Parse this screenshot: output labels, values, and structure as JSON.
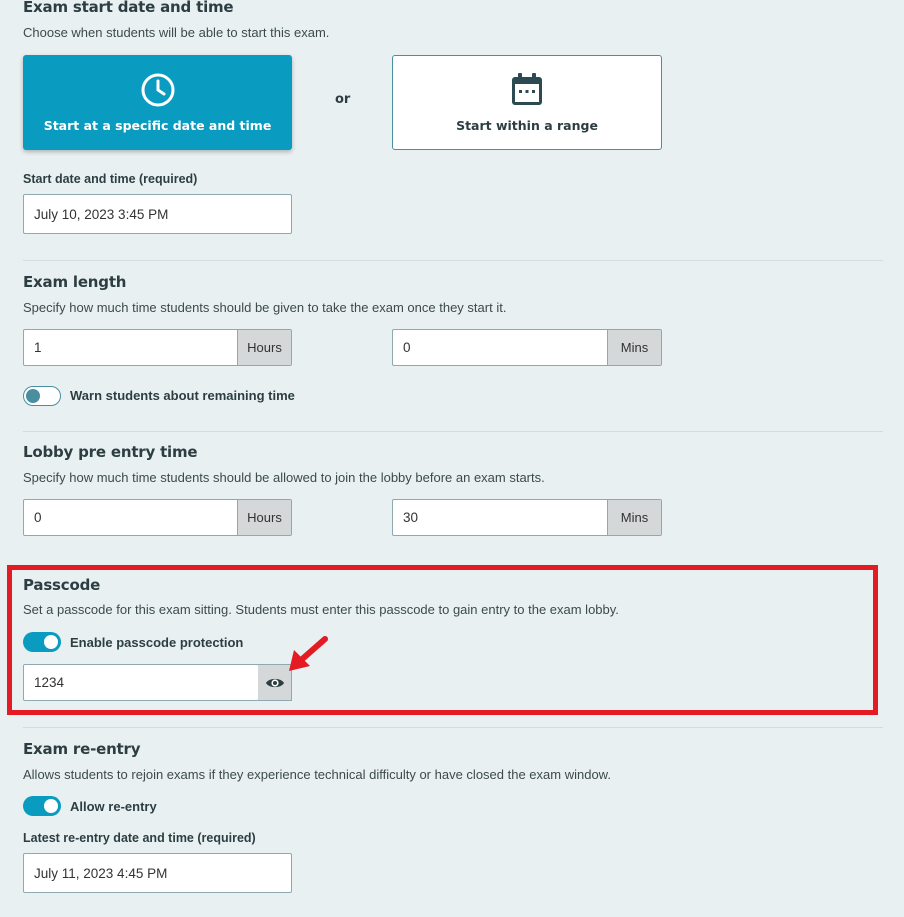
{
  "start": {
    "title": "Exam start date and time",
    "description": "Choose when students will be able to start this exam.",
    "option_specific": "Start at a specific date and time",
    "or_text": "or",
    "option_range": "Start within a range",
    "field_label": "Start date and time (required)",
    "field_value": "July 10, 2023 3:45 PM"
  },
  "length": {
    "title": "Exam length",
    "description": "Specify how much time students should be given to take the exam once they start it.",
    "hours_value": "1",
    "hours_addon": "Hours",
    "mins_value": "0",
    "mins_addon": "Mins",
    "warn_label": "Warn students about remaining time",
    "warn_enabled": false
  },
  "lobby": {
    "title": "Lobby pre entry time",
    "description": "Specify how much time students should be allowed to join the lobby before an exam starts.",
    "hours_value": "0",
    "hours_addon": "Hours",
    "mins_value": "30",
    "mins_addon": "Mins"
  },
  "passcode": {
    "title": "Passcode",
    "description": "Set a passcode for this exam sitting. Students must enter this passcode to gain entry to the exam lobby.",
    "toggle_label": "Enable passcode protection",
    "enabled": true,
    "value": "1234"
  },
  "reentry": {
    "title": "Exam re-entry",
    "description": "Allows students to rejoin exams if they experience technical difficulty or have closed the exam window.",
    "toggle_label": "Allow re-entry",
    "enabled": true,
    "field_label": "Latest re-entry date and time (required)",
    "field_value": "July 11, 2023 4:45 PM"
  },
  "colors": {
    "accent": "#0a9bc0",
    "highlight": "#e41b23",
    "background": "#e9f0f2"
  }
}
